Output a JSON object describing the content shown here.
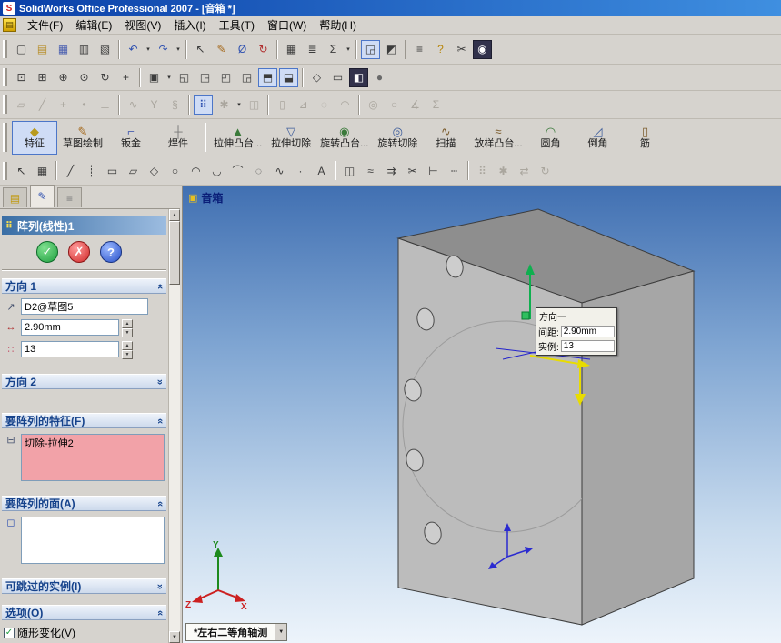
{
  "window": {
    "title": "SolidWorks Office Professional 2007 - [音箱 *]"
  },
  "menu": {
    "items": [
      {
        "type": "menu",
        "name": "menu-file",
        "label": "文件(F)"
      },
      {
        "type": "menu",
        "name": "menu-edit",
        "label": "编辑(E)"
      },
      {
        "type": "menu",
        "name": "menu-view",
        "label": "视图(V)"
      },
      {
        "type": "menu",
        "name": "menu-insert",
        "label": "插入(I)"
      },
      {
        "type": "menu",
        "name": "menu-tools",
        "label": "工具(T)"
      },
      {
        "type": "menu",
        "name": "menu-window",
        "label": "窗口(W)"
      },
      {
        "type": "menu",
        "name": "menu-help",
        "label": "帮助(H)"
      }
    ]
  },
  "icons": {
    "app_logo": "S",
    "doc_menu": "▤",
    "caret_small": "▾",
    "caret_down": "▼",
    "scroll_up": "▲",
    "scroll_down": "▼",
    "spin_up": "▲",
    "spin_down": "▼",
    "chevron": "«",
    "check": "✓",
    "ok": "✓",
    "cancel": "✗",
    "help": "?",
    "pm_header": "⠿",
    "doc_label_icon": "▣",
    "dir_ref": "↗",
    "spacing": "↔",
    "count": "∷",
    "feature_item": "⊟",
    "face_item": "◻"
  },
  "toolbars": {
    "standard": [
      {
        "name": "new-document-icon",
        "glyph": "▢"
      },
      {
        "name": "open-document-icon",
        "glyph": "▤",
        "color": "#b8902e"
      },
      {
        "name": "save-icon",
        "glyph": "▦",
        "color": "#4a5fb0"
      },
      {
        "name": "print-icon",
        "glyph": "▥"
      },
      {
        "name": "print-preview-icon",
        "glyph": "▧"
      },
      {
        "type": "sep"
      },
      {
        "name": "undo-icon",
        "glyph": "↶",
        "color": "#2e50b0"
      },
      {
        "type": "caret",
        "name": "undo-dropdown-caret"
      },
      {
        "name": "redo-icon",
        "glyph": "↷",
        "color": "#2e50b0"
      },
      {
        "type": "caret",
        "name": "redo-dropdown-caret"
      },
      {
        "type": "sep"
      },
      {
        "name": "select-icon",
        "glyph": "↖"
      },
      {
        "name": "sketch-toggle-icon",
        "glyph": "✎",
        "color": "#a5691c"
      },
      {
        "name": "smart-dimension-icon",
        "glyph": "Ø",
        "color": "#2e50b0"
      },
      {
        "name": "rebuild-icon",
        "glyph": "↻",
        "color": "#b03030"
      },
      {
        "type": "sep"
      },
      {
        "name": "design-table-icon",
        "glyph": "▦"
      },
      {
        "name": "annotation-icon",
        "glyph": "≣"
      },
      {
        "name": "equations-icon",
        "glyph": "Σ"
      },
      {
        "type": "caret",
        "name": "annotation-dropdown-caret"
      },
      {
        "type": "sep"
      },
      {
        "name": "fullscreen-view-icon",
        "glyph": "◲",
        "pressed": true
      },
      {
        "name": "section-view-icon",
        "glyph": "◩"
      },
      {
        "type": "sep"
      },
      {
        "name": "options-icon",
        "glyph": "≡"
      },
      {
        "name": "help-icon",
        "glyph": "?",
        "color": "#b8860b"
      },
      {
        "name": "cut-icon",
        "glyph": "✂"
      },
      {
        "name": "screen-capture-icon",
        "glyph": "◉",
        "cls": "dark"
      }
    ],
    "view": [
      {
        "name": "zoom-to-fit-icon",
        "glyph": "⊡"
      },
      {
        "name": "zoom-to-area-icon",
        "glyph": "⊞"
      },
      {
        "name": "zoom-in-out-icon",
        "glyph": "⊕"
      },
      {
        "name": "zoom-to-selection-icon",
        "glyph": "⊙"
      },
      {
        "name": "rotate-view-icon",
        "glyph": "↻"
      },
      {
        "name": "pan-icon",
        "glyph": "+"
      },
      {
        "type": "sep"
      },
      {
        "name": "standard-views-icon",
        "glyph": "▣"
      },
      {
        "type": "caret",
        "name": "standard-views-caret"
      },
      {
        "name": "front-view-icon",
        "glyph": "◱"
      },
      {
        "name": "back-view-icon",
        "glyph": "◳"
      },
      {
        "name": "left-view-icon",
        "glyph": "◰"
      },
      {
        "name": "right-view-icon",
        "glyph": "◲"
      },
      {
        "name": "top-view-icon",
        "glyph": "⬒",
        "pressed": true
      },
      {
        "name": "isometric-view-icon",
        "glyph": "⬓",
        "pressed": true
      },
      {
        "type": "sep"
      },
      {
        "name": "wireframe-icon",
        "glyph": "◇"
      },
      {
        "name": "hidden-lines-icon",
        "glyph": "▭"
      },
      {
        "name": "shaded-with-edges-icon",
        "glyph": "◧",
        "cls": "dark"
      },
      {
        "name": "shaded-icon",
        "glyph": "●",
        "color": "#6a6a6a"
      }
    ],
    "reference": [
      {
        "name": "insert-plane-icon",
        "glyph": "▱",
        "disabled": true
      },
      {
        "name": "insert-axis-icon",
        "glyph": "╱",
        "disabled": true
      },
      {
        "name": "coordinate-system-icon",
        "glyph": "+",
        "disabled": true
      },
      {
        "name": "insert-point-icon",
        "glyph": "•",
        "disabled": true
      },
      {
        "name": "mate-reference-icon",
        "glyph": "⊥",
        "disabled": true
      },
      {
        "type": "sep"
      },
      {
        "name": "curve-icon",
        "glyph": "∿",
        "disabled": true
      },
      {
        "name": "split-line-icon",
        "glyph": "Y",
        "disabled": true
      },
      {
        "name": "helix-icon",
        "glyph": "§",
        "disabled": true
      },
      {
        "type": "sep"
      },
      {
        "name": "linear-pattern-icon",
        "glyph": "⠿",
        "pressed": true,
        "color": "#2e50b0"
      },
      {
        "name": "circular-pattern-icon",
        "glyph": "✱",
        "disabled": true
      },
      {
        "type": "caret",
        "name": "pattern-dropdown-caret"
      },
      {
        "name": "mirror-feature-icon",
        "glyph": "◫",
        "disabled": true
      },
      {
        "type": "sep"
      },
      {
        "name": "rib-icon",
        "glyph": "▯",
        "disabled": true
      },
      {
        "name": "draft-icon",
        "glyph": "⊿",
        "disabled": true
      },
      {
        "name": "shell-icon",
        "glyph": "◌",
        "disabled": true
      },
      {
        "name": "dome-icon",
        "glyph": "◠",
        "disabled": true
      },
      {
        "type": "sep"
      },
      {
        "name": "hole-wizard-icon",
        "glyph": "◎",
        "disabled": true
      },
      {
        "name": "simple-hole-icon",
        "glyph": "○",
        "disabled": true
      },
      {
        "name": "measure-icon",
        "glyph": "∡",
        "disabled": true
      },
      {
        "name": "mass-properties-icon",
        "glyph": "Σ",
        "disabled": true
      }
    ],
    "features": [
      {
        "type": "feat",
        "name": "features-tab",
        "label": "特征",
        "glyph": "◆",
        "pressed": true,
        "color": "#b89a1e"
      },
      {
        "type": "feat",
        "name": "sketch-tab",
        "label": "草图绘制",
        "glyph": "✎",
        "color": "#a5691c"
      },
      {
        "type": "feat",
        "name": "sheet-metal-tab",
        "label": "钣金",
        "glyph": "⌐",
        "color": "#4a5fb0"
      },
      {
        "type": "feat",
        "name": "weldments-tab",
        "label": "焊件",
        "glyph": "┼",
        "color": "#777777"
      },
      {
        "type": "sep"
      },
      {
        "type": "feat",
        "name": "extruded-boss-button",
        "label": "拉伸凸台...",
        "glyph": "▲",
        "color": "#3a7a3a"
      },
      {
        "type": "feat",
        "name": "extruded-cut-button",
        "label": "拉伸切除",
        "glyph": "▽",
        "color": "#3a5a9a"
      },
      {
        "type": "feat",
        "name": "revolved-boss-button",
        "label": "旋转凸台...",
        "glyph": "◉",
        "color": "#3a7a3a"
      },
      {
        "type": "feat",
        "name": "revolved-cut-button",
        "label": "旋转切除",
        "glyph": "◎",
        "color": "#3a5a9a"
      },
      {
        "type": "feat",
        "name": "sweep-button",
        "label": "扫描",
        "glyph": "∿",
        "color": "#7a5a2a"
      },
      {
        "type": "feat",
        "name": "loft-button",
        "label": "放样凸台...",
        "glyph": "≈",
        "color": "#7a5a2a"
      },
      {
        "type": "feat",
        "name": "fillet-button",
        "label": "圆角",
        "glyph": "◠",
        "color": "#3a7a3a"
      },
      {
        "type": "feat",
        "name": "chamfer-button",
        "label": "倒角",
        "glyph": "◿",
        "color": "#3a5a9a"
      },
      {
        "type": "feat",
        "name": "rib-button",
        "label": "筋",
        "glyph": "▯",
        "color": "#7a5a2a"
      }
    ],
    "sketch": [
      {
        "name": "select-icon",
        "glyph": "↖"
      },
      {
        "name": "grid-icon",
        "glyph": "▦"
      },
      {
        "type": "sep"
      },
      {
        "name": "line-icon",
        "glyph": "╱"
      },
      {
        "name": "centerline-icon",
        "glyph": "┊"
      },
      {
        "name": "rectangle-icon",
        "glyph": "▭"
      },
      {
        "name": "parallelogram-icon",
        "glyph": "▱"
      },
      {
        "name": "polygon-icon",
        "glyph": "◇"
      },
      {
        "name": "circle-icon",
        "glyph": "○"
      },
      {
        "name": "centerpoint-arc-icon",
        "glyph": "◠"
      },
      {
        "name": "tangent-arc-icon",
        "glyph": "◡"
      },
      {
        "name": "three-point-arc-icon",
        "glyph": "⌒"
      },
      {
        "name": "ellipse-icon",
        "glyph": "◌"
      },
      {
        "name": "spline-icon",
        "glyph": "∿"
      },
      {
        "name": "point-icon",
        "glyph": "·"
      },
      {
        "name": "text-icon",
        "glyph": "A"
      },
      {
        "type": "sep"
      },
      {
        "name": "mirror-entities-icon",
        "glyph": "◫"
      },
      {
        "name": "offset-entities-icon",
        "glyph": "≈"
      },
      {
        "name": "convert-entities-icon",
        "glyph": "⇉"
      },
      {
        "name": "trim-entities-icon",
        "glyph": "✂"
      },
      {
        "name": "extend-entities-icon",
        "glyph": "⊢"
      },
      {
        "name": "construction-geometry-icon",
        "glyph": "┄"
      },
      {
        "type": "sep"
      },
      {
        "name": "linear-sketch-pattern-icon",
        "glyph": "⠿",
        "disabled": true
      },
      {
        "name": "circular-sketch-pattern-icon",
        "glyph": "✱",
        "disabled": true
      },
      {
        "name": "move-entities-icon",
        "glyph": "⇄",
        "disabled": true
      },
      {
        "name": "rotate-entities-icon",
        "glyph": "↻",
        "disabled": true
      }
    ]
  },
  "panel": {
    "tabs": [
      {
        "name": "feature-manager-tab",
        "glyph": "▤",
        "color": "#c09a10",
        "cls": "ptab"
      },
      {
        "name": "property-manager-tab",
        "glyph": "✎",
        "color": "#2e50b0",
        "cls": "ptab active"
      },
      {
        "name": "configuration-manager-tab",
        "glyph": "≡",
        "color": "#777777",
        "cls": "ptab"
      }
    ]
  },
  "property_manager": {
    "title": "阵列(线性)1",
    "direction1": {
      "label": "方向 1",
      "reference": "D2@草图5",
      "spacing": "2.90mm",
      "instances": "13"
    },
    "direction2": {
      "label": "方向 2"
    },
    "features_group": {
      "label": "要阵列的特征(F)",
      "item": "切除-拉伸2"
    },
    "faces_group": {
      "label": "要阵列的面(A)"
    },
    "skip_group": {
      "label": "可跳过的实例(I)"
    },
    "options_group": {
      "label": "选项(O)",
      "vary_sketch": "随形变化(V)",
      "checked": true
    }
  },
  "viewport": {
    "doc_label": "音箱",
    "callout": {
      "title": "方向一",
      "spacing_label": "间距:",
      "spacing_value": "2.90mm",
      "instances_label": "实例:",
      "instances_value": "13"
    },
    "view_orientation_tab": "*左右二等角轴测",
    "triad": {
      "x": "X",
      "y": "Y",
      "z": "Z"
    }
  },
  "colors": {
    "titlebar_start": "#0a3fa8",
    "titlebar_end": "#3f8fe0",
    "toolbar_bg": "#d6d3ce",
    "pm_header_start": "#3a6ea5",
    "pm_header_end": "#9cbce0",
    "group_header_text": "#15428b",
    "selection_pink": "#f2a2a8",
    "viewport_top": "#4170b2",
    "viewport_bottom": "#edf4fb",
    "model_front": "#bcbcbc",
    "model_top": "#8e8e8e",
    "model_side": "#a6a6a6"
  }
}
